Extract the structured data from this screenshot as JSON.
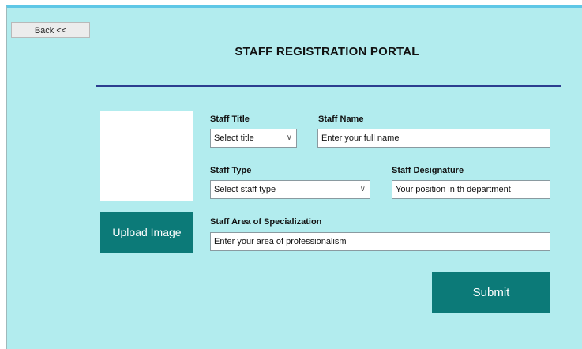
{
  "header": {
    "back_label": "Back <<",
    "title": "STAFF REGISTRATION PORTAL"
  },
  "photo": {
    "upload_label": "Upload Image"
  },
  "form": {
    "staff_title": {
      "label": "Staff Title",
      "value": "Select title"
    },
    "staff_name": {
      "label": "Staff Name",
      "value": "Enter your full name"
    },
    "staff_type": {
      "label": "Staff Type",
      "value": "Select staff type"
    },
    "staff_designation": {
      "label": "Staff Designature",
      "value": "Your position in th department"
    },
    "specialization": {
      "label": "Staff Area of Specialization",
      "value": "Enter your area of professionalism"
    },
    "submit_label": "Submit"
  },
  "colors": {
    "background": "#b2ecee",
    "accent": "#0c7a78",
    "divider": "#2c3e8f",
    "top_bar": "#5ec7e6"
  },
  "icons": {
    "dropdown": "chevron-down-icon"
  }
}
